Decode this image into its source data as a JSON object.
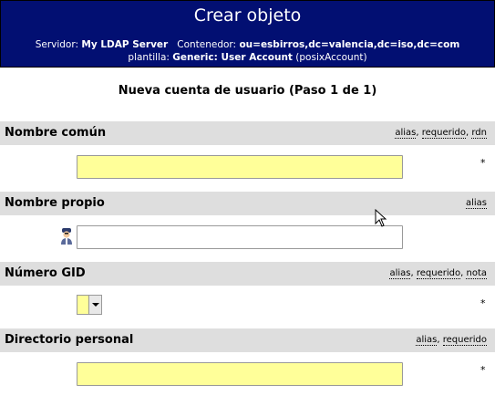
{
  "header": {
    "title": "Crear objeto",
    "server_label": "Servidor:",
    "server_value": "My LDAP Server",
    "container_label": "Contenedor:",
    "container_value": "ou=esbirros,dc=valencia,dc=iso,dc=com",
    "template_label": "plantilla:",
    "template_value": "Generic: User Account",
    "template_extra": "(posixAccount)"
  },
  "subtitle": "Nueva cuenta de usuario (Paso 1 de 1)",
  "fields": [
    {
      "label": "Nombre común",
      "flags": [
        "alias",
        "requerido",
        "rdn"
      ],
      "required": true,
      "value": ""
    },
    {
      "label": "Nombre propio",
      "flags": [
        "alias"
      ],
      "required": false,
      "value": ""
    },
    {
      "label": "Número GID",
      "flags": [
        "alias",
        "requerido",
        "nota"
      ],
      "required": true,
      "value": ""
    },
    {
      "label": "Directorio personal",
      "flags": [
        "alias",
        "requerido"
      ],
      "required": true,
      "value": ""
    }
  ],
  "required_marker": "*",
  "separator": ",",
  "colors": {
    "header_bg": "#020f72",
    "section_bg": "#dedede",
    "required_field_bg": "#ffff99"
  },
  "icons": [
    "person-icon",
    "chevron-down-icon",
    "mouse-cursor-icon"
  ]
}
